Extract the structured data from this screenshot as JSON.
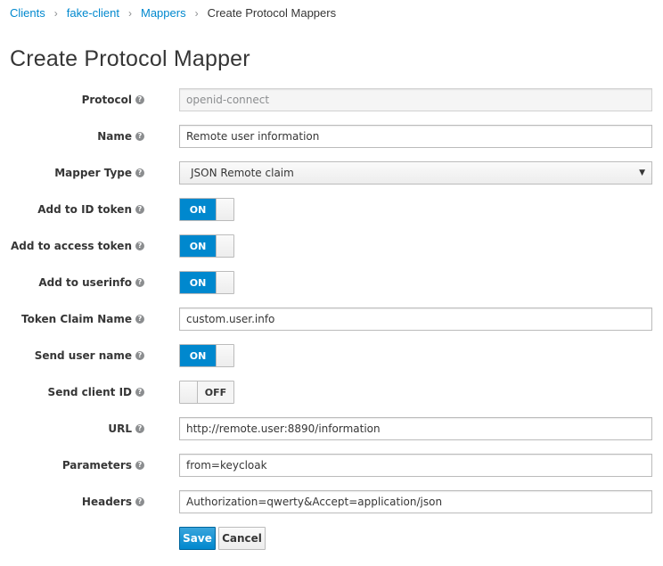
{
  "breadcrumb": {
    "items": [
      "Clients",
      "fake-client",
      "Mappers"
    ],
    "current": "Create Protocol Mappers",
    "separator": "›"
  },
  "page": {
    "title": "Create Protocol Mapper"
  },
  "help_glyph": "?",
  "form": {
    "protocol": {
      "label": "Protocol",
      "value": "openid-connect"
    },
    "name": {
      "label": "Name",
      "value": "Remote user information"
    },
    "mapper_type": {
      "label": "Mapper Type",
      "value": "JSON Remote claim",
      "caret": "▼"
    },
    "add_to_id_token": {
      "label": "Add to ID token",
      "state": "ON"
    },
    "add_to_access_token": {
      "label": "Add to access token",
      "state": "ON"
    },
    "add_to_userinfo": {
      "label": "Add to userinfo",
      "state": "ON"
    },
    "token_claim_name": {
      "label": "Token Claim Name",
      "value": "custom.user.info"
    },
    "send_user_name": {
      "label": "Send user name",
      "state": "ON"
    },
    "send_client_id": {
      "label": "Send client ID",
      "state": "OFF"
    },
    "url": {
      "label": "URL",
      "value": "http://remote.user:8890/information"
    },
    "parameters": {
      "label": "Parameters",
      "value": "from=keycloak"
    },
    "headers": {
      "label": "Headers",
      "value": "Authorization=qwerty&Accept=application/json"
    }
  },
  "actions": {
    "save_label": "Save",
    "cancel_label": "Cancel"
  },
  "colors": {
    "accent": "#0088ce",
    "link": "#0088ce",
    "text": "#363636"
  }
}
